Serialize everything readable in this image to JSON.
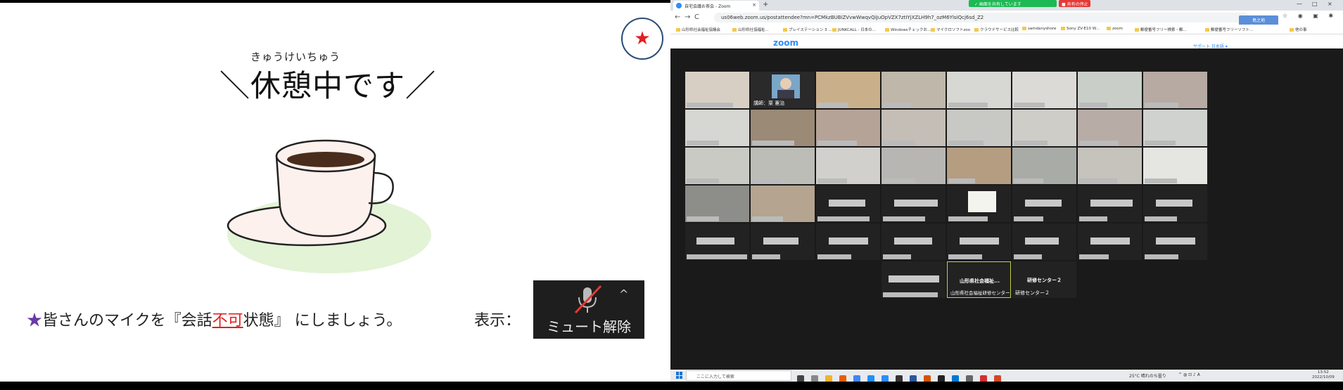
{
  "slide": {
    "ruby": "きゅうけいちゅう",
    "title": "＼休憩中です／",
    "star_badge": "★",
    "instruction": {
      "star": "★",
      "pre": "皆さんのマイクを『会話",
      "emphasis": "不可",
      "post": "状態』 にしましょう。"
    },
    "display_label": "表示：",
    "mute_button_label": "ミュート解除",
    "mute_caret": "^"
  },
  "browser": {
    "tab_title": "自宅会議お茶会 - Zoom",
    "tab_close": "×",
    "new_tab": "+",
    "share_banner": "✓ 画面を共有しています",
    "stop_share": "■ 共有の停止",
    "window_controls": [
      "—",
      "□",
      "×"
    ],
    "nav": [
      "←",
      "→",
      "C",
      "🔒"
    ],
    "url": "us06web.zoom.us/postattendee?mn=PCMkzBUBiZVvwWwqvQiJuOpVZX7ztIYjXZLH9h7_ozM6YlsIQcj6sd_Z2",
    "profile_badge": "島之地\n研修センター",
    "bookmarks": [
      "山形県社会福祉協議会",
      "山形県社協福祉...",
      "ブレイステーション 3 ...",
      "JUNKCALL : 日本の...",
      "Windowsチェックお...",
      "マイクロソフトzoo",
      "クラウドサービス比較",
      "samdanyshore",
      "Sony ZV-E10 W...",
      "zoom",
      "郵便番号フリー検索・郵...",
      "郵便番号フリーソフト...",
      "他の事"
    ],
    "zoom_logo": "zoom",
    "support_links": "サポート  日本語 ▾"
  },
  "meeting": {
    "teacher_label": "講師：栗 憲治",
    "tile_a_title": "山形県社会福祉...",
    "tile_a_label": "山形県社会福祉研修センター",
    "tile_b_title": "研修センター２",
    "tile_b_label": "研修センター２"
  },
  "taskbar": {
    "search_placeholder": "ここに入力して検索",
    "weather": "25°C 晴れのち曇り",
    "tray": "^  ◍  ⊡  ♪  A",
    "time": "13:52",
    "date": "2022/10/09"
  },
  "colors": {
    "accent_red": "#e02020",
    "accent_purple": "#6a3aa8",
    "zoom_blue": "#2d8cff",
    "share_green": "#1db954"
  }
}
